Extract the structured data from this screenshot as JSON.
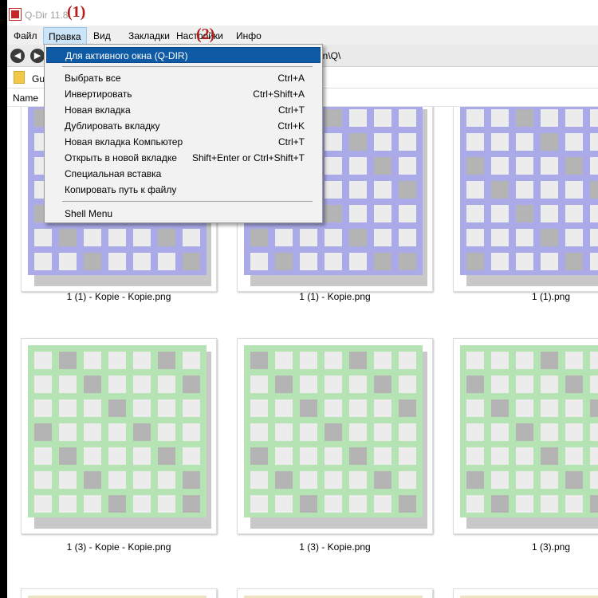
{
  "app": {
    "title": "Q-Dir 11.8",
    "annotation1": "(1)",
    "annotation2": "(2)"
  },
  "menubar": {
    "items": [
      {
        "label": "Файл"
      },
      {
        "label": "Правка"
      },
      {
        "label": "Вид"
      },
      {
        "label": "Закладки"
      },
      {
        "label": "Настройки"
      },
      {
        "label": "Инфо"
      }
    ]
  },
  "navbar": {
    "back_icon": "back-arrow-icon",
    "forward_icon": "forward-arrow-icon",
    "path_fragment": "on\\Q\\"
  },
  "favbar": {
    "label": "Gu"
  },
  "columns": {
    "name": "Name"
  },
  "dropdown": {
    "items": [
      {
        "label": "Для активного окна (Q-DIR)",
        "shortcut": "",
        "highlight": true
      },
      {
        "label": "Выбрать все",
        "shortcut": "Ctrl+A"
      },
      {
        "label": "Инвертировать",
        "shortcut": "Ctrl+Shift+A"
      },
      {
        "label": "Новая вкладка",
        "shortcut": "Ctrl+T"
      },
      {
        "label": "Дублировать вкладку",
        "shortcut": "Ctrl+K"
      },
      {
        "label": "Новая вкладка Компьютер",
        "shortcut": "Ctrl+T"
      },
      {
        "label": "Открыть в новой вкладке",
        "shortcut": "Shift+Enter or Ctrl+Shift+T"
      },
      {
        "label": "Специальная вставка",
        "shortcut": ""
      },
      {
        "label": "Копировать путь к файлу",
        "shortcut": ""
      },
      {
        "label": "Shell Menu",
        "shortcut": ""
      }
    ]
  },
  "files": [
    {
      "name": "1 (1) - Kopie - Kopie.png",
      "color": "#aaaae8"
    },
    {
      "name": "1 (1) - Kopie.png",
      "color": "#aaaae8"
    },
    {
      "name": "1 (1).png",
      "color": "#aaaae8"
    },
    {
      "name": "1 (3) - Kopie - Kopie.png",
      "color": "#b5e3b3"
    },
    {
      "name": "1 (3) - Kopie.png",
      "color": "#b5e3b3"
    },
    {
      "name": "1 (3).png",
      "color": "#b5e3b3"
    }
  ],
  "colors": {
    "highlight": "#0f5aa5",
    "cell_light": "#ececec",
    "cell_dark": "#b4b4b4",
    "row3_color": "#ece3c0"
  }
}
